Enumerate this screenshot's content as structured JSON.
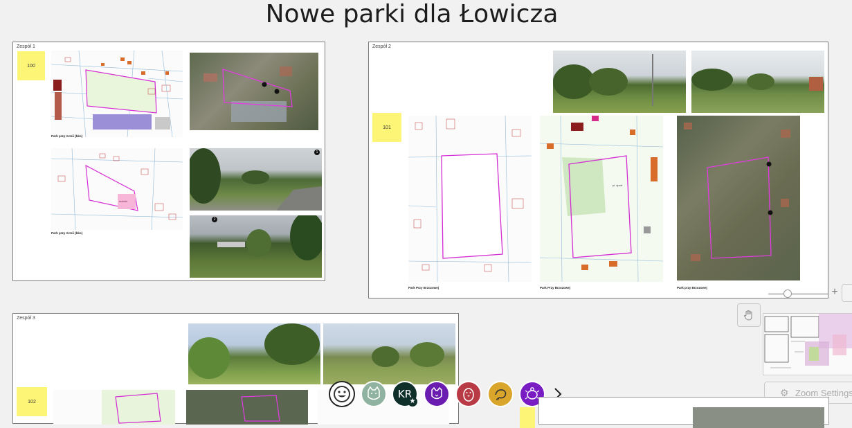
{
  "page": {
    "title": "Nowe parki dla Łowicza"
  },
  "boards": [
    {
      "label": "Zespół 1",
      "sticky": "100",
      "caption_top": "Park przy Armii (bko)",
      "caption_bottom": "Park przy Armii (bko)",
      "pink_note": "ścieżki"
    },
    {
      "label": "Zespół 2",
      "sticky": "101",
      "caption_1": "Park Przy Brzozowej",
      "caption_2": "Park Przy Brzozowej",
      "caption_3": "Park przy Brzozowej",
      "area_label": "pl. sport"
    },
    {
      "label": "Zespół 3",
      "sticky": "102"
    }
  ],
  "markers": [
    "1",
    "2"
  ],
  "collaborators": [
    {
      "initials": "",
      "icon": "smiley-icon",
      "color": "#ffffff"
    },
    {
      "initials": "",
      "icon": "cat-icon",
      "color": "#8fb3a0"
    },
    {
      "initials": "KR",
      "icon": "star-badge-icon",
      "color": "#0f2f2b"
    },
    {
      "initials": "",
      "icon": "cat-face-icon",
      "color": "#6a1bb0"
    },
    {
      "initials": "",
      "icon": "penguin-icon",
      "color": "#b73a45"
    },
    {
      "initials": "",
      "icon": "shrimp-icon",
      "color": "#d9a52b"
    },
    {
      "initials": "",
      "icon": "turtle-icon",
      "color": "#7a1cc4"
    }
  ],
  "controls": {
    "zoom_settings": "Zoom Settings",
    "zoom_in": "+"
  }
}
